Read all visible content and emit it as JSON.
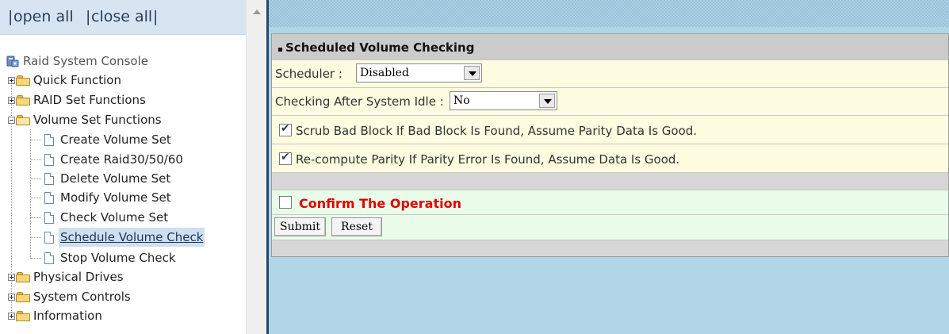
{
  "topbar": {
    "pipe_left": "|",
    "open_all": "open all",
    "pipe_mid": "|",
    "close_all": "close all",
    "pipe_right": "|"
  },
  "tree": {
    "root": "Raid System Console",
    "folders": {
      "quick": "Quick Function",
      "raid_set": "RAID Set Functions",
      "volume_set": "Volume Set Functions",
      "physical": "Physical Drives",
      "system": "System Controls",
      "info": "Information"
    },
    "volume_items": [
      "Create Volume Set",
      "Create Raid30/50/60",
      "Delete Volume Set",
      "Modify Volume Set",
      "Check Volume Set",
      "Schedule Volume Check",
      "Stop Volume Check"
    ],
    "selected_item": "Schedule Volume Check"
  },
  "form": {
    "title": "Scheduled Volume Checking",
    "scheduler_label": "Scheduler :",
    "scheduler_value": "Disabled",
    "idle_label": "Checking After System Idle :",
    "idle_value": "No",
    "scrub_label": "Scrub Bad Block If Bad Block Is Found, Assume Parity Data Is Good.",
    "scrub_checked": true,
    "recompute_label": "Re-compute Parity If Parity Error Is Found, Assume Data Is Good.",
    "recompute_checked": true,
    "confirm_label": "Confirm The Operation",
    "confirm_checked": false,
    "submit_label": "Submit",
    "reset_label": "Reset"
  },
  "colors": {
    "topbar_bg": "#d7e4f2",
    "frame_bg": "#b0d6e8",
    "header_bg": "#cbcbcb",
    "yellow_row": "#fdfce0",
    "green_row": "#e9fce9",
    "confirm_text": "#e00000"
  },
  "icons": {
    "console": "server-console-icon",
    "folder": "folder-icon",
    "document": "document-icon",
    "expand": "plus-box-icon",
    "collapse": "minus-box-icon",
    "dropdown": "chevron-down-icon",
    "scroll_up": "scroll-up-arrow-icon"
  }
}
